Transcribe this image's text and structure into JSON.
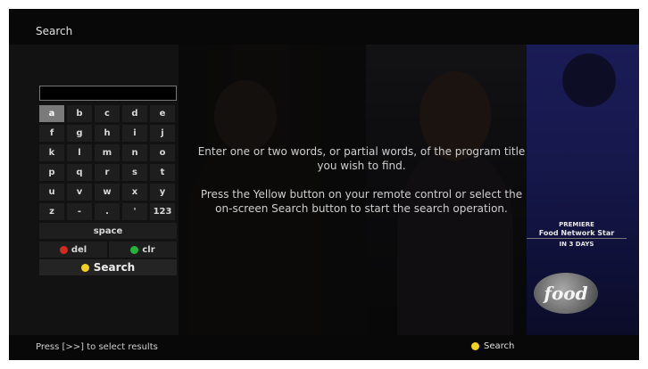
{
  "header": {
    "title": "Search"
  },
  "search_input": {
    "value": ""
  },
  "keyboard": {
    "keys": [
      "a",
      "b",
      "c",
      "d",
      "e",
      "f",
      "g",
      "h",
      "i",
      "j",
      "k",
      "l",
      "m",
      "n",
      "o",
      "p",
      "q",
      "r",
      "s",
      "t",
      "u",
      "v",
      "w",
      "x",
      "y",
      "z",
      "-",
      ".",
      "'",
      "123"
    ],
    "selected_key": "a",
    "space_label": "space",
    "del_label": "del",
    "clr_label": "clr",
    "search_label": "Search"
  },
  "instructions": {
    "line1": "Enter one or two words, or partial words, of the program title you wish to find.",
    "line2": "Press the Yellow button on your remote control or select the on-screen Search button to start the search operation."
  },
  "promo": {
    "tag": "PREMIERE",
    "show": "Food Network Star",
    "when": "IN 3 DAYS",
    "logo": "food"
  },
  "footer": {
    "hint": "Press [>>] to select results",
    "search_label": "Search"
  },
  "colors": {
    "red_button": "#d42a1e",
    "green_button": "#27b33a",
    "yellow_button": "#f2d21b"
  },
  "icons": {
    "del": "red-circle-icon",
    "clr": "green-circle-icon",
    "search": "yellow-circle-icon"
  }
}
